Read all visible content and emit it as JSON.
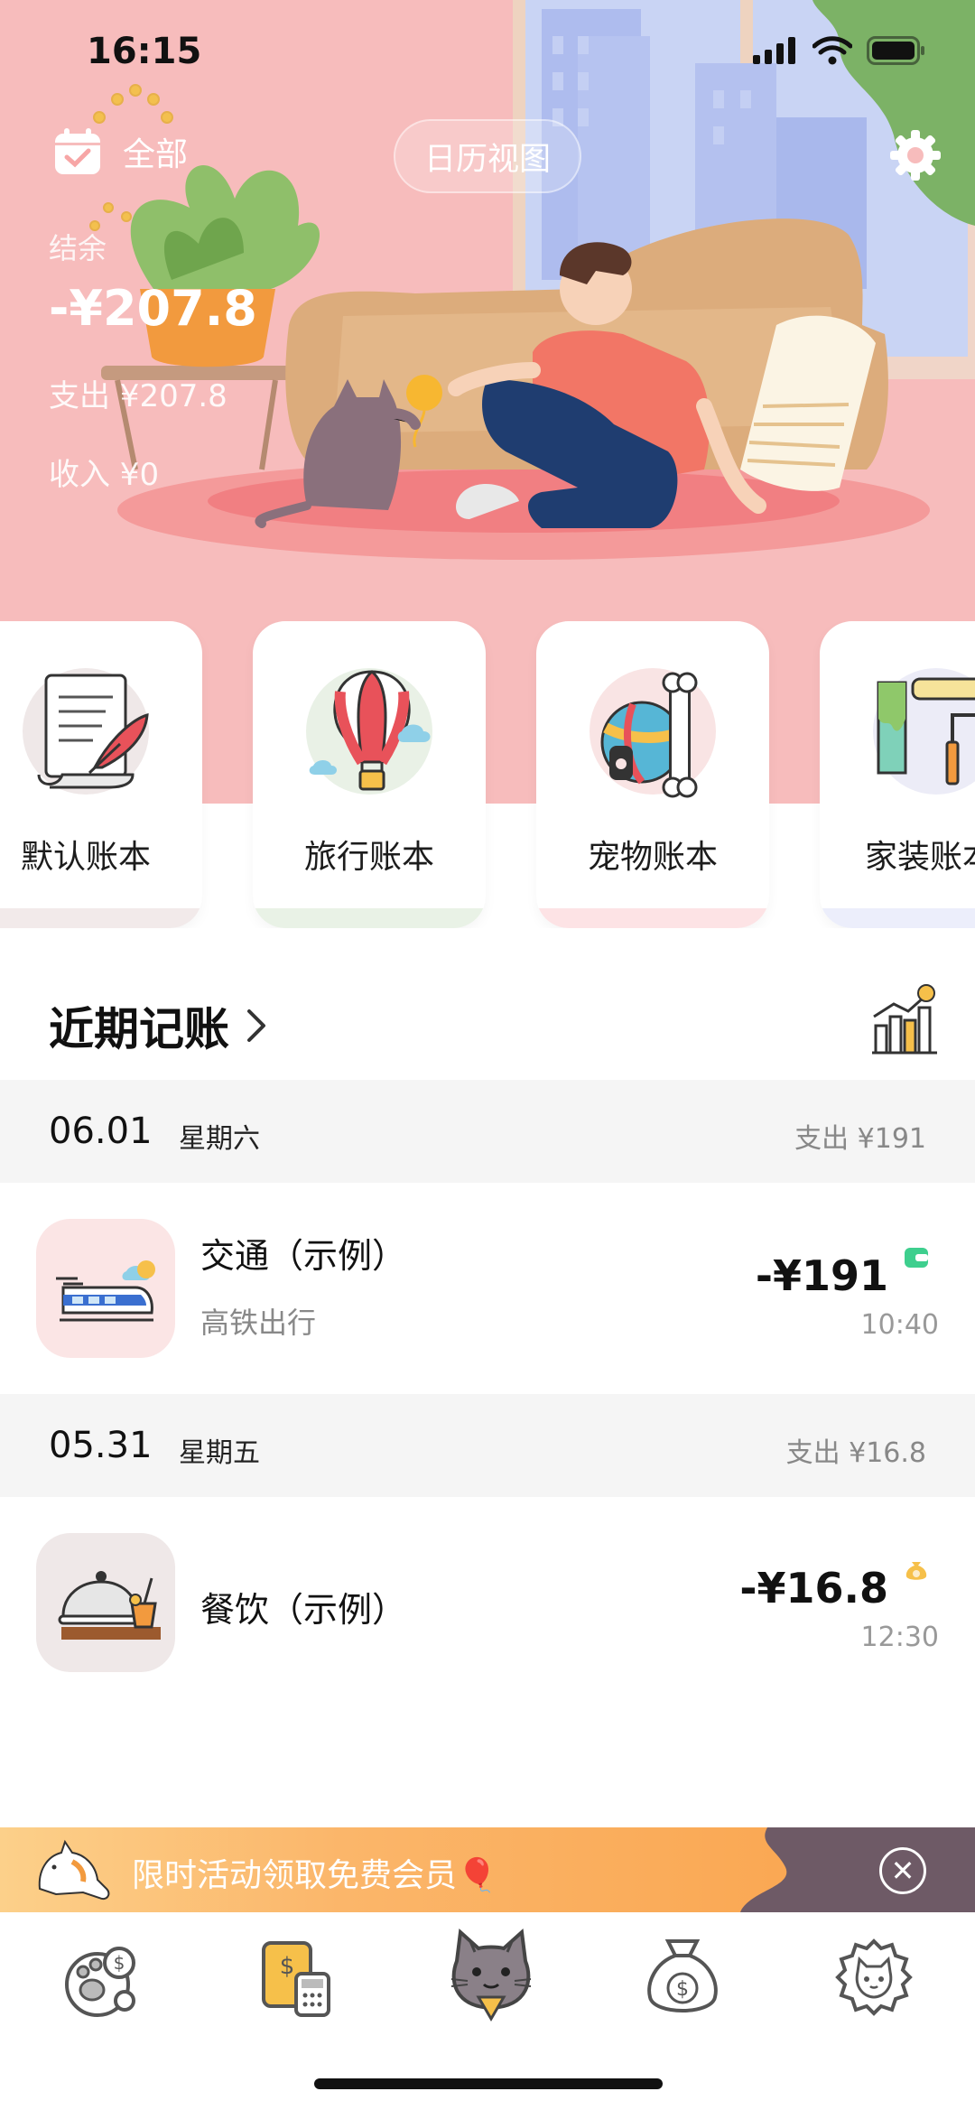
{
  "status_bar": {
    "time": "16:15"
  },
  "header": {
    "book_switch_label": "全部",
    "calendar_view_label": "日历视图",
    "icons": {
      "book_switch": "calendar-check-icon",
      "settings": "gear-icon"
    }
  },
  "summary": {
    "balance_label": "结余",
    "balance_value": "-¥207.8",
    "expense_text": "支出 ¥207.8",
    "income_text": "收入 ¥0"
  },
  "books": [
    {
      "name": "默认账本",
      "icon": "quill-scroll-icon",
      "tint": "#efe8e8",
      "strip": "#f2eaea"
    },
    {
      "name": "旅行账本",
      "icon": "hot-air-balloon-icon",
      "tint": "#e9f1e6",
      "strip": "#e9f2e6"
    },
    {
      "name": "宠物账本",
      "icon": "pet-ball-bone-icon",
      "tint": "#f9e4e4",
      "strip": "#fde3e5"
    },
    {
      "name": "家装账本",
      "icon": "paint-roller-icon",
      "tint": "#ececf7",
      "strip": "#eceefb"
    }
  ],
  "recent": {
    "title": "近期记账",
    "stats_icon": "bar-chart-coin-icon",
    "groups": [
      {
        "date": "06.01",
        "weekday": "星期六",
        "summary": "支出 ¥191",
        "records": [
          {
            "category": "交通（示例）",
            "note": "高铁出行",
            "amount": "-¥191",
            "time": "10:40",
            "icon": "train-icon",
            "pay_icon": "wallet-icon",
            "icon_bg": "#fbe5e5"
          }
        ]
      },
      {
        "date": "05.31",
        "weekday": "星期五",
        "summary": "支出 ¥16.8",
        "records": [
          {
            "category": "餐饮（示例）",
            "note": "",
            "amount": "-¥16.8",
            "time": "12:30",
            "icon": "food-cloche-icon",
            "pay_icon": "coin-bag-icon",
            "icon_bg": "#efe8e8"
          }
        ]
      }
    ]
  },
  "promo": {
    "text": "限时活动领取免费会员🎈",
    "close_label": "✕",
    "cat_icon": "cat-stretch-icon"
  },
  "tabbar": {
    "tabs": [
      {
        "icon": "paw-coin-icon"
      },
      {
        "icon": "bill-calculator-icon"
      },
      {
        "icon": "cat-mascot-icon"
      },
      {
        "icon": "money-bag-icon"
      },
      {
        "icon": "cat-gear-icon"
      }
    ]
  },
  "colors": {
    "hero_bg": "#f7bcbc",
    "accent_orange": "#f9a24a",
    "pay_green": "#3ecf8e",
    "pay_gold": "#f6c04a"
  }
}
